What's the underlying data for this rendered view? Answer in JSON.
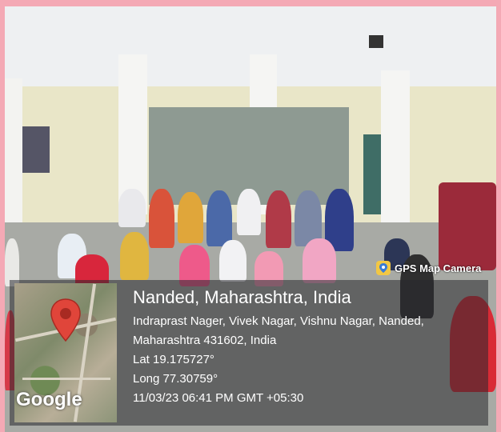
{
  "overlay": {
    "badge_label": "GPS Map Camera",
    "map_logo": "Google",
    "city_line": "Nanded, Maharashtra, India",
    "address_line1": "Indraprast Nager, Vivek Nagar, Vishnu Nagar, Nanded,",
    "address_line2": "Maharashtra 431602, India",
    "lat": "Lat 19.175727°",
    "long": "Long 77.30759°",
    "datetime": "11/03/23 06:41 PM GMT +05:30"
  },
  "icons": [
    "map-pin-icon",
    "gps-map-camera-icon"
  ],
  "colors": {
    "frame": "#f4a9b5",
    "pin": "#e0453a"
  }
}
